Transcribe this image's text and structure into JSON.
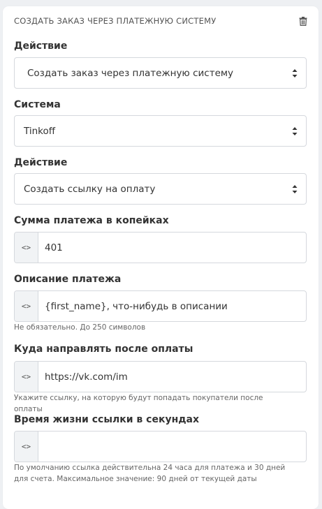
{
  "card": {
    "title": "СОЗДАТЬ ЗАКАЗ ЧЕРЕЗ ПЛАТЕЖНУЮ СИСТЕМУ",
    "delete_icon": "trash-icon"
  },
  "action1": {
    "label": "Действие",
    "value": "Создать заказ через платежную систему"
  },
  "system": {
    "label": "Система",
    "value": "Tinkoff"
  },
  "action2": {
    "label": "Действие",
    "value": "Создать ссылку на оплату"
  },
  "amount": {
    "label": "Сумма платежа в копейках",
    "addon": "<>",
    "value": "401"
  },
  "description": {
    "label": "Описание платежа",
    "addon": "<>",
    "value": "{first_name}, что-нибудь в описании",
    "hint": "Не обязательно. До 250 символов"
  },
  "redirect": {
    "label": "Куда направлять после оплаты",
    "addon": "<>",
    "value": "https://vk.com/im",
    "hint": "Укажите ссылку, на которую будут попадать покупатели после оплаты"
  },
  "lifetime": {
    "label": "Время жизни ссылки в секундах",
    "addon": "<>",
    "value": "",
    "hint": "По умолчанию ссылка действительна 24 часа для платежа и 30 дней для счета. Максимальное значение: 90 дней от текущей даты"
  }
}
